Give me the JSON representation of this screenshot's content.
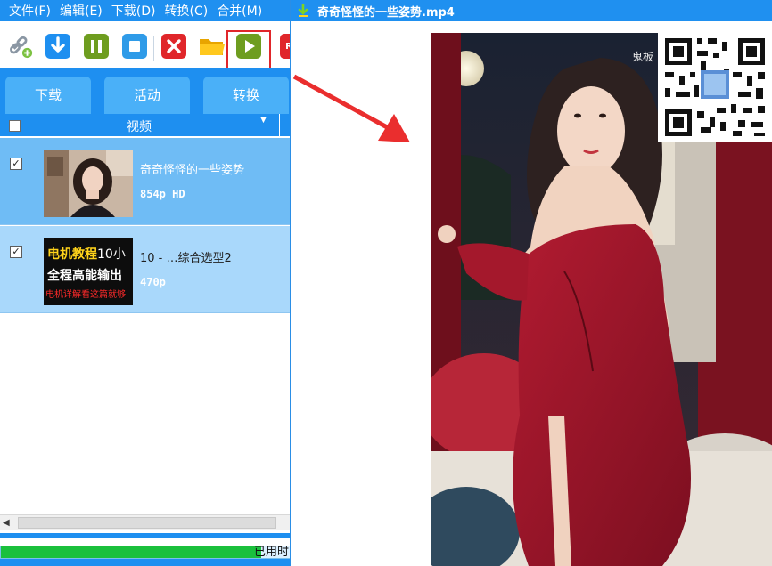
{
  "menu": {
    "items": [
      "文件(F)",
      "编辑(E)",
      "下载(D)",
      "转换(C)",
      "合并(M)"
    ]
  },
  "toolbar": {
    "icons": [
      "link-add-icon",
      "download-icon",
      "pause-icon",
      "stop-icon",
      "delete-icon",
      "folder-icon",
      "play-icon",
      "record-icon"
    ],
    "highlighted": "play-icon"
  },
  "tabs": [
    {
      "label": "下载"
    },
    {
      "label": "活动"
    },
    {
      "label": "转换"
    }
  ],
  "list": {
    "column_header": "视频",
    "rows": [
      {
        "title": "奇奇怪怪的一些姿势",
        "resolution": "854p  HD",
        "checked": true,
        "selected": true
      },
      {
        "title": "10 - …综合选型2",
        "resolution": "470p",
        "checked": true,
        "selected": false,
        "thumb_line1": "电机教程",
        "thumb_line1_suffix": "10小",
        "thumb_line2": "全程高能输出",
        "thumb_line3": "电机详解看这篇就够"
      }
    ]
  },
  "status": {
    "elapsed_label": "已用时",
    "progress_percent": 90
  },
  "player": {
    "title": "奇奇怪怪的一些姿势.mp4",
    "watermark_text": "鬼板"
  },
  "colors": {
    "accent": "#1e8ff0",
    "tab": "#4ab0f8",
    "row_selected": "#6fbcf5",
    "row_normal": "#a9d8fb",
    "highlight_box": "#e0262a",
    "progress_fill": "#1ac03c"
  }
}
